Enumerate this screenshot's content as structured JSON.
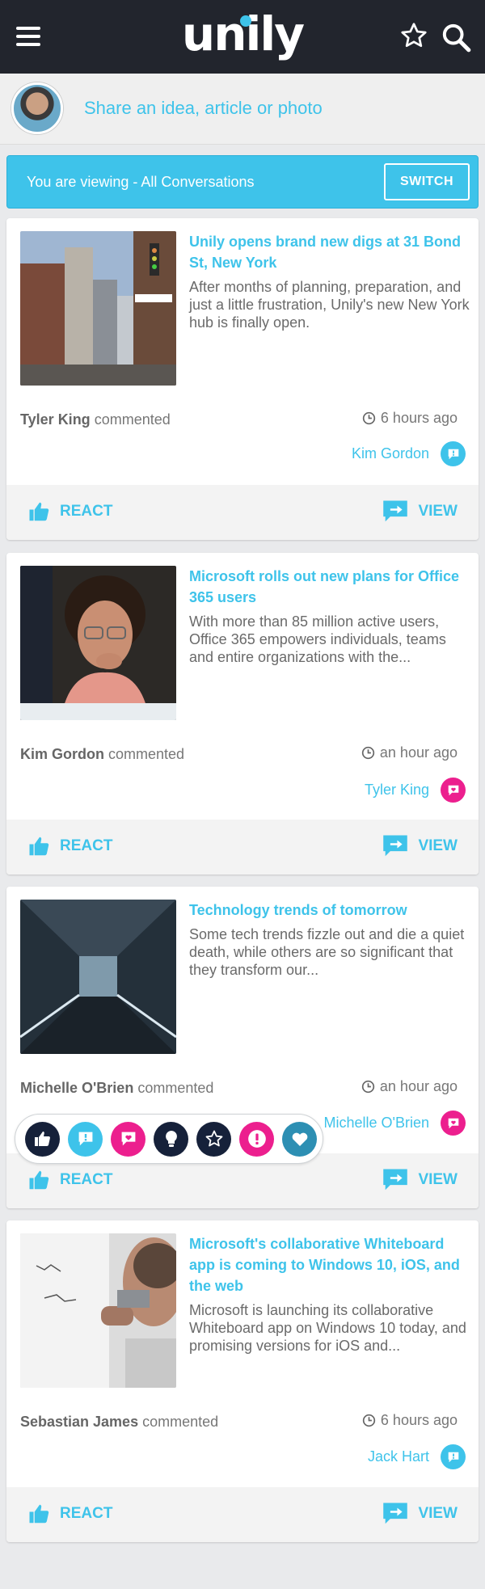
{
  "header": {
    "logo": "unily",
    "colors": {
      "bar": "#22252d",
      "accent": "#3ec3ea"
    },
    "icons": [
      "hamburger-menu-icon",
      "star-icon",
      "search-icon"
    ]
  },
  "composer": {
    "prompt": "Share an idea, article or photo"
  },
  "viewing_banner": {
    "label": "You are viewing - All Conversations",
    "switch_label": "SWITCH"
  },
  "posts": [
    {
      "title": "Unily opens brand new digs at 31 Bond St, New York",
      "excerpt": "After months of planning, preparation, and just a little frustration, Unily's new New York hub is finally open.",
      "author": "Tyler King",
      "action": "commented",
      "time": "6 hours ago",
      "commenter": "Kim Gordon",
      "badge_color": "#3ec3ea",
      "react_label": "REACT",
      "view_label": "VIEW"
    },
    {
      "title": "Microsoft rolls out new plans for Office 365 users",
      "excerpt": "With more than 85 million active users, Office 365 empowers individuals, teams and entire organizations with the...",
      "author": "Kim Gordon",
      "action": "commented",
      "time": "an hour ago",
      "commenter": "Tyler King",
      "badge_color": "#ec1f8e",
      "react_label": "REACT",
      "view_label": "VIEW"
    },
    {
      "title": "Technology trends of tomorrow",
      "excerpt": "Some tech trends fizzle out and die a quiet death, while others are so significant that they transform our...",
      "author": "Michelle O'Brien",
      "action": "commented",
      "time": "an hour ago",
      "commenter": "Michelle O'Brien",
      "badge_color": "#ec1f8e",
      "react_label": "REACT",
      "view_label": "VIEW"
    },
    {
      "title": "Microsoft's collaborative Whiteboard app is coming to Windows 10, iOS, and the web",
      "excerpt": "Microsoft is launching its collaborative Whiteboard app on Windows 10 today, and promising versions for iOS and...",
      "author": "Sebastian James",
      "action": "commented",
      "time": "6 hours ago",
      "commenter": "Jack Hart",
      "badge_color": "#3ec3ea",
      "react_label": "REACT",
      "view_label": "VIEW"
    }
  ],
  "reactions": [
    {
      "icon": "thumbs-up-icon",
      "color": "#16213a"
    },
    {
      "icon": "comment-exclamation-icon",
      "color": "#3ec3ea"
    },
    {
      "icon": "comment-heart-icon",
      "color": "#ec1f8e"
    },
    {
      "icon": "lightbulb-icon",
      "color": "#16213a"
    },
    {
      "icon": "star-icon",
      "color": "#16213a"
    },
    {
      "icon": "exclamation-icon",
      "color": "#ec1f8e"
    },
    {
      "icon": "heart-icon",
      "color": "#2d8fb3"
    }
  ]
}
